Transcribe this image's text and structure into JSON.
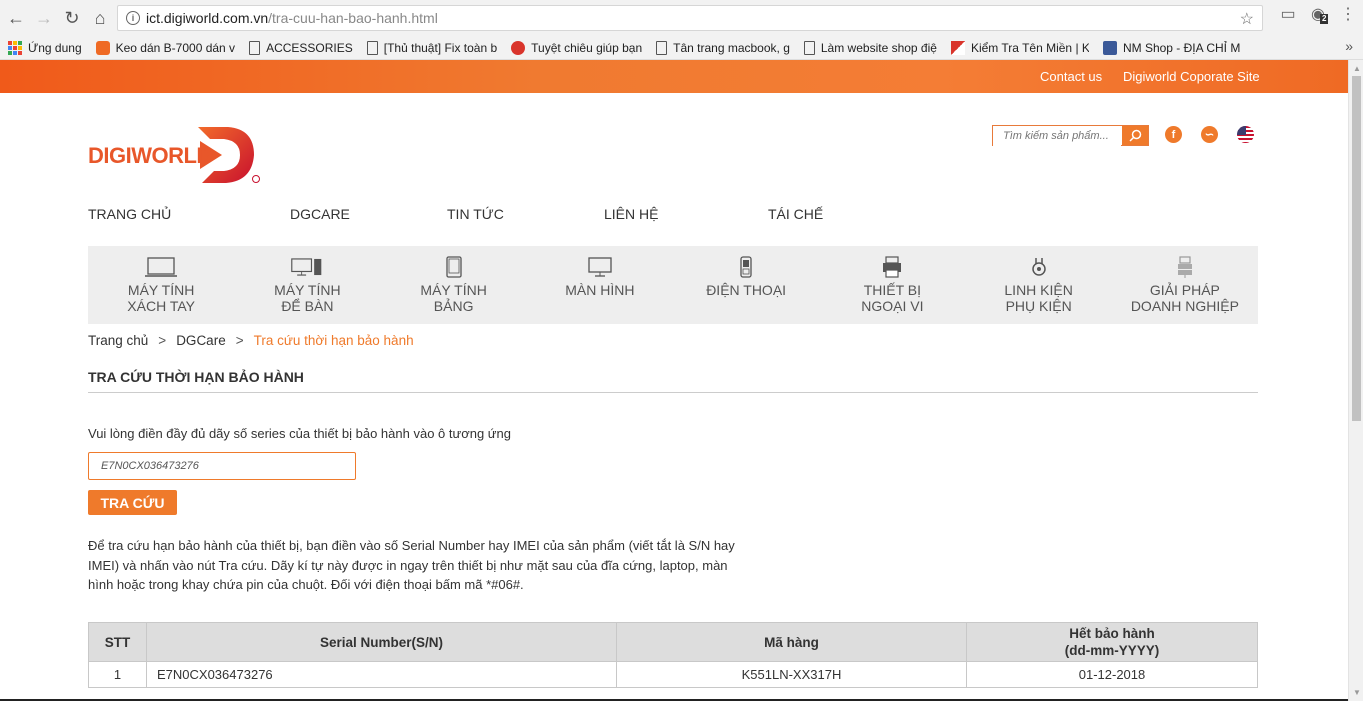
{
  "browser": {
    "url_host": "ict.digiworld.com.vn",
    "url_path": "/tra-cuu-han-bao-hanh.html",
    "profile_badge": "2"
  },
  "bookmarks": [
    {
      "label": "Ứng dung",
      "icon": "apps-grid-icon"
    },
    {
      "label": "Keo dán B-7000 dán v",
      "icon": "youtube-icon"
    },
    {
      "label": "ACCESSORIES",
      "icon": "page-icon"
    },
    {
      "label": "[Thủ thuật] Fix toàn b",
      "icon": "page-icon"
    },
    {
      "label": "Tuyệt chiêu giúp bạn",
      "icon": "site-icon"
    },
    {
      "label": "Tân trang macbook, g",
      "icon": "page-icon"
    },
    {
      "label": "Làm website shop điệ",
      "icon": "page-icon"
    },
    {
      "label": "Kiểm Tra Tên Miền | K",
      "icon": "site-icon"
    },
    {
      "label": "NM Shop - ĐỊA CHỈ M",
      "icon": "facebook-icon"
    }
  ],
  "topbar": {
    "contact": "Contact us",
    "corporate": "Digiworld Coporate Site"
  },
  "logo": {
    "text": "DIGIWORLD"
  },
  "search": {
    "placeholder": "Tìm kiếm sản phẩm..."
  },
  "main_nav": [
    "TRANG CHỦ",
    "DGCARE",
    "TIN TỨC",
    "LIÊN HỆ",
    "TÁI CHẾ"
  ],
  "categories": [
    {
      "line1": "MÁY TÍNH",
      "line2": "XÁCH TAY",
      "icon": "laptop-icon"
    },
    {
      "line1": "MÁY TÍNH",
      "line2": "ĐỂ BÀN",
      "icon": "desktop-icon"
    },
    {
      "line1": "MÁY TÍNH",
      "line2": "BẢNG",
      "icon": "tablet-icon"
    },
    {
      "line1": "MÀN HÌNH",
      "line2": "",
      "icon": "monitor-icon"
    },
    {
      "line1": "ĐIỆN THOẠI",
      "line2": "",
      "icon": "phone-icon"
    },
    {
      "line1": "THIẾT BỊ",
      "line2": "NGOẠI VI",
      "icon": "printer-icon"
    },
    {
      "line1": "LINH KIỆN",
      "line2": "PHỤ KIỆN",
      "icon": "component-icon"
    },
    {
      "line1": "GIẢI PHÁP",
      "line2": "DOANH NGHIỆP",
      "icon": "enterprise-icon"
    }
  ],
  "breadcrumb": {
    "home": "Trang chủ",
    "parent": "DGCare",
    "current": "Tra cứu thời hạn bảo hành",
    "separator": ">"
  },
  "section_title": "TRA CỨU THỜI HẠN BẢO HÀNH",
  "form": {
    "instruction": "Vui lòng điền đầy đủ dãy số series của thiết bị bảo hành vào ô tương ứng",
    "serial_value": "E7N0CX036473276",
    "submit_label": "TRA CỨU"
  },
  "help_text": "Để tra cứu hạn bảo hành của thiết bị, bạn điền vào số Serial Number hay IMEI của sản phẩm (viết tắt là S/N hay IMEI) và nhấn vào nút Tra cứu. Dãy kí tự này được in ngay trên thiết bị như mặt sau của đĩa cứng, laptop, màn hình hoặc trong khay chứa pin của chuột. Đối với điện thoại bấm mã *#06#.",
  "results": {
    "headers": {
      "stt": "STT",
      "serial": "Serial Number(S/N)",
      "model": "Mã hàng",
      "expiry_line1": "Hết bảo hành",
      "expiry_line2": "(dd-mm-YYYY)"
    },
    "rows": [
      {
        "stt": "1",
        "serial": "E7N0CX036473276",
        "model": "K551LN-XX317H",
        "expiry": "01-12-2018"
      }
    ]
  },
  "colors": {
    "accent": "#ef7a2b",
    "brand": "#e8572a"
  }
}
